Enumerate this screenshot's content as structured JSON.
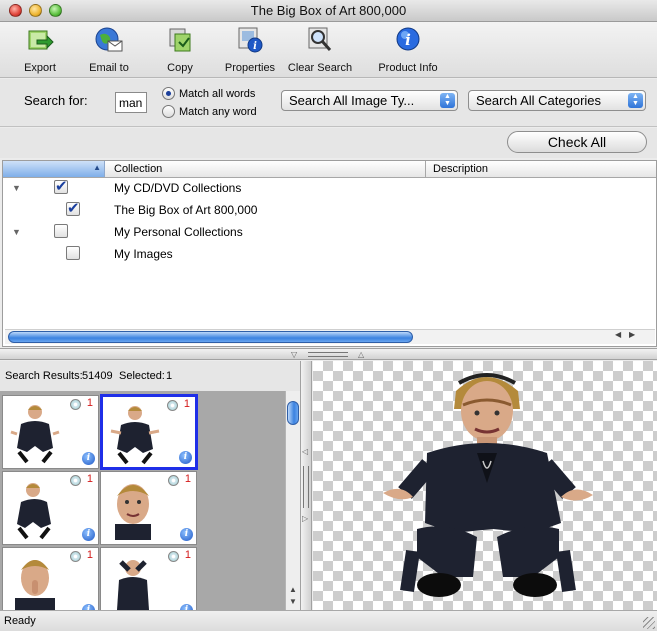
{
  "window": {
    "title": "The Big Box of Art 800,000"
  },
  "toolbar": {
    "buttons": [
      {
        "label": "Export",
        "icon": "export-icon"
      },
      {
        "label": "Email to",
        "icon": "email-icon"
      },
      {
        "label": "Copy",
        "icon": "copy-icon"
      },
      {
        "label": "Properties",
        "icon": "properties-icon"
      },
      {
        "label": "Clear Search",
        "icon": "clear-search-icon"
      },
      {
        "label": "Product Info",
        "icon": "product-info-icon"
      }
    ]
  },
  "search": {
    "label": "Search for:",
    "value": "man",
    "match_all_label": "Match all words",
    "match_any_label": "Match any word",
    "match_mode": "all",
    "image_type_value": "Search All Image Ty...",
    "category_value": "Search All Categories"
  },
  "check_all_label": "Check All",
  "collections": {
    "columns": {
      "collection": "Collection",
      "description": "Description"
    },
    "rows": [
      {
        "label": "My CD/DVD Collections",
        "checked": true,
        "level": 0,
        "expanded": true
      },
      {
        "label": "The Big Box of Art 800,000",
        "checked": true,
        "level": 1
      },
      {
        "label": "My Personal Collections",
        "checked": false,
        "level": 0,
        "expanded": true
      },
      {
        "label": "My Images",
        "checked": false,
        "level": 1
      }
    ]
  },
  "results": {
    "count_label": "Search Results:",
    "count": "51409",
    "selected_label": "Selected:",
    "selected": "1",
    "thumbnails": [
      {
        "count": "1",
        "selected": false
      },
      {
        "count": "1",
        "selected": true
      },
      {
        "count": "1",
        "selected": false
      },
      {
        "count": "1",
        "selected": false
      },
      {
        "count": "1",
        "selected": false
      },
      {
        "count": "1",
        "selected": false
      }
    ]
  },
  "status": "Ready"
}
